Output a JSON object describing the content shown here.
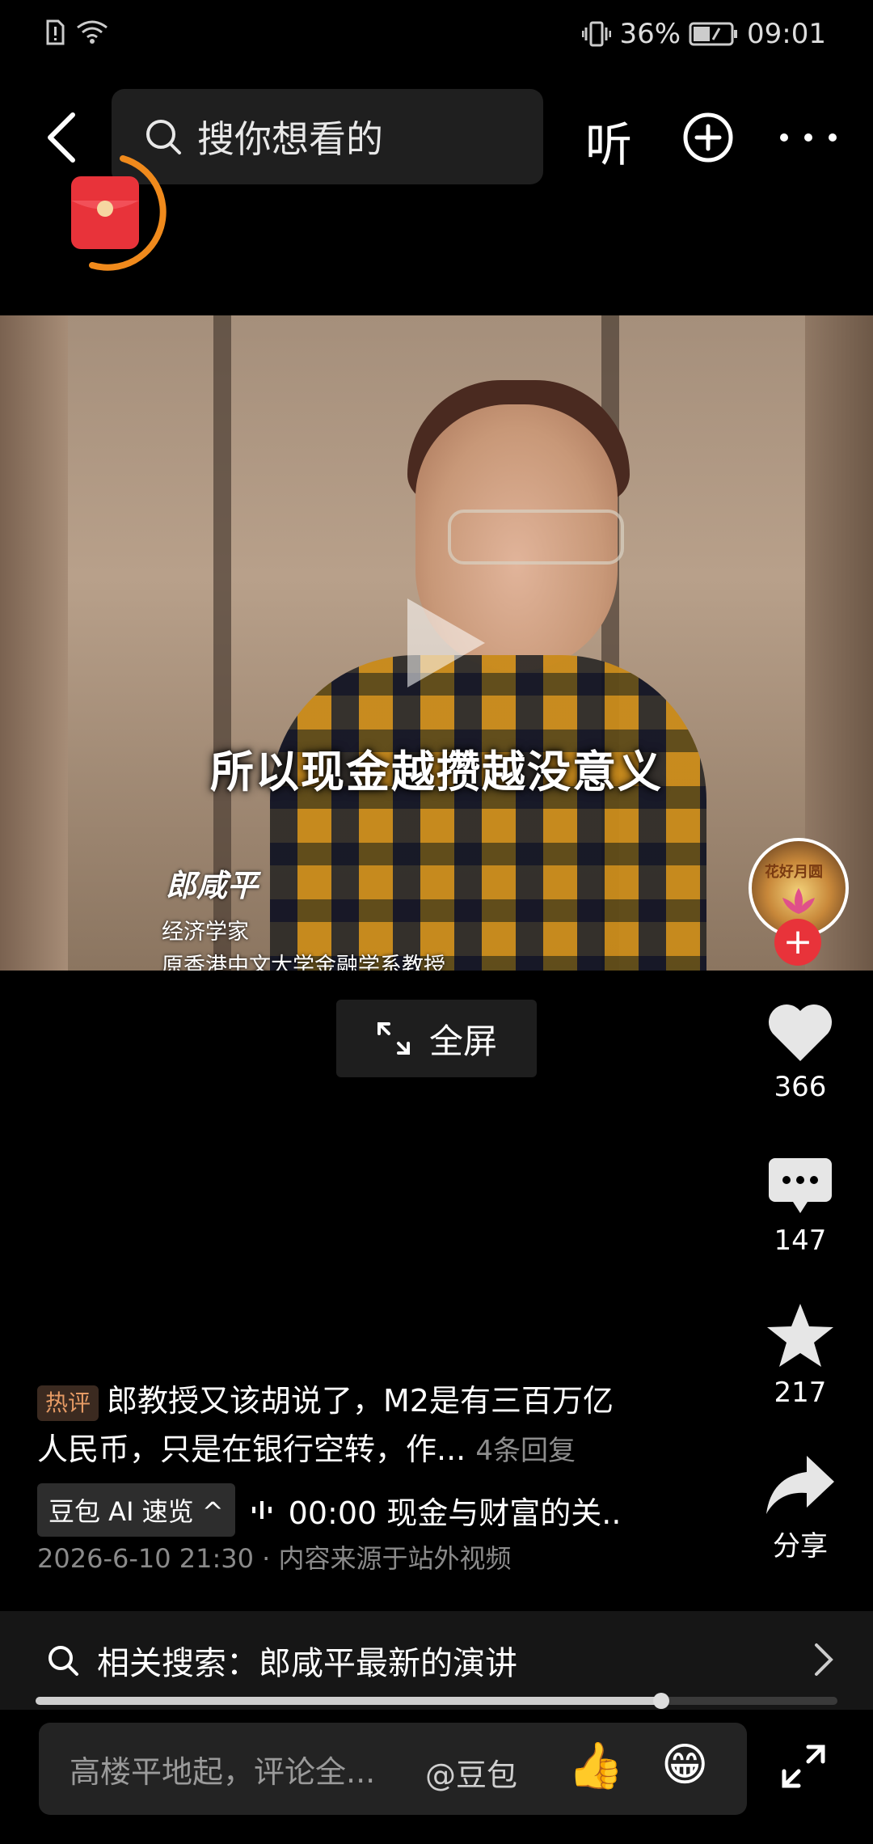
{
  "status_bar": {
    "battery_percent": "36%",
    "time": "09:01",
    "icons": [
      "sim-alert-icon",
      "wifi-icon",
      "vibrate-icon",
      "battery-icon"
    ]
  },
  "top_nav": {
    "search_placeholder": "搜你想看的",
    "listen_label": "听",
    "icons": [
      "back-icon",
      "search-icon",
      "add-icon",
      "more-icon",
      "red-packet-icon"
    ]
  },
  "video": {
    "subtitle": "所以现金越攒越没意义",
    "caption_name": "郎咸平",
    "caption_title": "经济学家",
    "caption_sub": "原香港中文大学金融学系教授",
    "avatar_text": "花好月圆"
  },
  "fullscreen_label": "全屏",
  "actions": {
    "likes": "366",
    "comments": "147",
    "favorites": "217",
    "share_label": "分享"
  },
  "hot_comment": {
    "tag": "热评",
    "text_line1": "郎教授又该胡说了，M2是有三百万亿",
    "text_line2": "人民币，只是在银行空转，作...",
    "replies": "4条回复"
  },
  "ai_summary": {
    "tag": "豆包 AI 速览",
    "text": "00:00 现金与财富的关.."
  },
  "meta": {
    "date_source": "2026-6-10 21:30 · 内容来源于站外视频"
  },
  "related_search": {
    "label": "相关搜索：郎咸平最新的演讲"
  },
  "progress": {
    "played_fraction": 0.78
  },
  "comment_input": {
    "placeholder": "高楼平地起，评论全...",
    "mention": "@豆包",
    "emoji1": "👍",
    "emoji2": "😁"
  },
  "colors": {
    "background": "#000000",
    "accent_red": "#e8333a",
    "hot_tag_text": "#e59a64",
    "muted_text": "#8a8a8a"
  }
}
